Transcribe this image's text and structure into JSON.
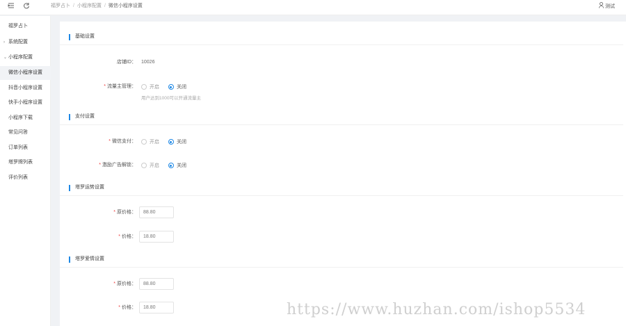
{
  "topbar": {
    "menu_icon": "menu-fold-icon",
    "refresh_icon": "refresh-icon",
    "breadcrumb": [
      "福罗占卜",
      "小程序配置",
      "微信小程序设置"
    ],
    "user_label": "测试"
  },
  "sidebar": {
    "items": [
      {
        "label": "福罗占卜",
        "type": "item"
      },
      {
        "label": "系统配置",
        "type": "group",
        "arrow": "›"
      },
      {
        "label": "小程序配置",
        "type": "group",
        "arrow": "⌄"
      },
      {
        "label": "微信小程序设置",
        "type": "item",
        "active": true
      },
      {
        "label": "抖音小程序设置",
        "type": "item"
      },
      {
        "label": "快手小程序设置",
        "type": "item"
      },
      {
        "label": "小程序下载",
        "type": "item"
      },
      {
        "label": "常见问答",
        "type": "item"
      },
      {
        "label": "订单列表",
        "type": "item"
      },
      {
        "label": "塔罗牌列表",
        "type": "item"
      },
      {
        "label": "评价列表",
        "type": "item"
      }
    ]
  },
  "sections": {
    "basic": {
      "title": "基础设置",
      "shop_id_label": "店铺ID：",
      "shop_id_value": "10026",
      "traffic_label": "流量主管理：",
      "traffic_options": [
        "开启",
        "关闭"
      ],
      "traffic_hint": "用户达到1000可以开通流量主"
    },
    "payment": {
      "title": "支付设置",
      "wechat_pay_label": "微信支付：",
      "wechat_pay_options": [
        "开启",
        "关闭"
      ],
      "ad_unlock_label": "激励广告解锁：",
      "ad_unlock_options": [
        "开启",
        "关闭"
      ]
    },
    "tarot_fortune": {
      "title": "塔罗运势设置",
      "original_price_label": "原价格：",
      "original_price_value": "88.80",
      "price_label": "价格：",
      "price_value": "18.80"
    },
    "tarot_love": {
      "title": "塔罗爱情设置",
      "original_price_label": "原价格：",
      "original_price_value": "88.80",
      "price_label": "价格：",
      "price_value": "18.80"
    }
  },
  "watermark": "https://www.huzhan.com/ishop5534",
  "colors": {
    "accent": "#1e88e5",
    "required": "#ee3b3b"
  }
}
